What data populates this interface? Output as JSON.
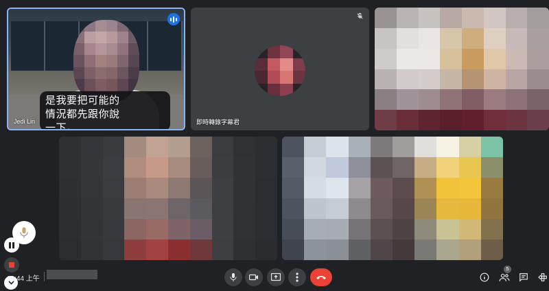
{
  "participants": [
    {
      "name": "Jedi Lin",
      "caption": "是我要把可能的情況都先跟你說一下。",
      "speaking": true
    },
    {
      "name": "即時轉錄字幕君",
      "muted": true
    },
    {
      "name": ""
    },
    {
      "name": ""
    },
    {
      "name": ""
    }
  ],
  "bottom_bar": {
    "time": "10:44 上午",
    "people_count": "5"
  },
  "colors": {
    "background": "#202124",
    "tile": "#3c4043",
    "leave": "#ea4335",
    "active_border": "#8ab4f8"
  },
  "icons": {
    "mic": "mic-icon",
    "camera": "camera-icon",
    "present": "present-screen-icon",
    "more": "more-vert-icon",
    "leave": "call-end-icon",
    "info": "info-icon",
    "people": "people-icon",
    "chat": "chat-icon",
    "activities": "activities-icon"
  },
  "mosaics": {
    "face": {
      "cols": 6,
      "rows": 7,
      "colors": [
        "#6f5a64",
        "#8b7783",
        "#a68c93",
        "#9c8590",
        "#7d6873",
        "#5b4b57",
        "#8a6f78",
        "#b99ea2",
        "#c3a7a6",
        "#b89a9d",
        "#9e828c",
        "#6e5a66",
        "#7a5f6a",
        "#a7858c",
        "#b6959a",
        "#a98b92",
        "#8f737e",
        "#5f4c58",
        "#6a525e",
        "#8e6f77",
        "#a1827f",
        "#9a7b7d",
        "#7e6570",
        "#574552",
        "#5c4652",
        "#7d5f67",
        "#8b6c6f",
        "#856669",
        "#6d5560",
        "#4d3c48",
        "#4e3b47",
        "#6c5058",
        "#7d5d61",
        "#74565b",
        "#5d4752",
        "#423440",
        "#433541",
        "#5a4550",
        "#6a5157",
        "#634b52",
        "#4f3e49",
        "#3a2f3a"
      ]
    },
    "avatar": {
      "cols": 4,
      "rows": 4,
      "colors": [
        "#2b2227",
        "#6d3440",
        "#934655",
        "#2b2227",
        "#5a2d3a",
        "#c45a61",
        "#e38b88",
        "#7f3c4a",
        "#4a2733",
        "#b14b55",
        "#d87672",
        "#6c3441",
        "#2b2227",
        "#6a2f3d",
        "#8c404f",
        "#2b2227"
      ]
    },
    "tile3": {
      "cols": 8,
      "rows": 6,
      "colors": [
        "#9a9393",
        "#b9b3b3",
        "#c9c3c0",
        "#b8aaa3",
        "#c9b9ae",
        "#d2c6c2",
        "#b9aeae",
        "#a49d9d",
        "#c9c4c4",
        "#e3dfdf",
        "#e9e6e4",
        "#d6c6a8",
        "#cfae7d",
        "#dfcfc1",
        "#c7b9b7",
        "#a99f9f",
        "#cfcbcb",
        "#ebe8e8",
        "#ebe8e6",
        "#d7c19b",
        "#c79c5e",
        "#e1c7a9",
        "#cbb9b3",
        "#ad9f9f",
        "#b8b2b3",
        "#d1cbcc",
        "#d4cdca",
        "#c6b6a5",
        "#b69372",
        "#ceb4a2",
        "#b8a6a4",
        "#9b8d8f",
        "#8c7f84",
        "#a1939a",
        "#9e8c8f",
        "#8f7377",
        "#815e63",
        "#9a7b7f",
        "#8d7378",
        "#7a6469",
        "#6e3d46",
        "#6a2e39",
        "#5e2430",
        "#5a1f2b",
        "#611f2d",
        "#702d3a",
        "#6c3441",
        "#6a3f4a"
      ]
    },
    "tile4": {
      "cols": 10,
      "rows": 6,
      "colors": [
        "#2e3033",
        "#33363a",
        "#393b3e",
        "#a38b80",
        "#c2a293",
        "#b39e90",
        "#6b615d",
        "#3a3c3f",
        "#2f3134",
        "#2c2e31",
        "#2e3033",
        "#34373a",
        "#3b3d40",
        "#b08d7e",
        "#c69a86",
        "#a78c7f",
        "#6a5e5c",
        "#3b3d40",
        "#303235",
        "#2c2e31",
        "#2d2f32",
        "#343639",
        "#3b3c3f",
        "#9b7d73",
        "#a88a7e",
        "#8e7a72",
        "#5b5558",
        "#3d3f42",
        "#303235",
        "#2b2d30",
        "#2c2e31",
        "#333538",
        "#393a3d",
        "#8a7670",
        "#8c7673",
        "#6e6568",
        "#5a5a5f",
        "#3e3f43",
        "#2f3134",
        "#2b2d30",
        "#2c2e31",
        "#323437",
        "#38393c",
        "#8b6662",
        "#9a6a66",
        "#7e6469",
        "#6a5d66",
        "#3f4044",
        "#2f3134",
        "#2b2d30",
        "#2b2d30",
        "#313336",
        "#37383b",
        "#8e3e3c",
        "#a24341",
        "#8c2f30",
        "#6f393b",
        "#3e3f42",
        "#2e3033",
        "#2a2c2f"
      ]
    },
    "tile5": {
      "cols": 10,
      "rows": 6,
      "colors": [
        "#4d5460",
        "#c6ccd3",
        "#dce3ea",
        "#a8b0b8",
        "#7d7a7c",
        "#a09e9d",
        "#e2dedb",
        "#f6f2e4",
        "#d6d0a2",
        "#7cc2a7",
        "#5a606b",
        "#d2d8df",
        "#c1cadd",
        "#8e8f98",
        "#5c5153",
        "#6f6565",
        "#c7ad86",
        "#f0d27a",
        "#e8c64f",
        "#8a8f6a",
        "#555b66",
        "#d6dce3",
        "#dfe5ec",
        "#a7a2a6",
        "#6d5b5d",
        "#5d4c4e",
        "#b09155",
        "#f0c33b",
        "#f2c53a",
        "#9a7b3f",
        "#4e545f",
        "#bec5cd",
        "#c5ccd4",
        "#8f8a8d",
        "#6b5a5c",
        "#574748",
        "#9b8556",
        "#e5b93d",
        "#e6b738",
        "#91743e",
        "#474d57",
        "#a6adb5",
        "#a6acb2",
        "#767476",
        "#5c5052",
        "#4e4244",
        "#8d8b79",
        "#c8c294",
        "#d1b877",
        "#83704d",
        "#3f444d",
        "#8d939a",
        "#8b9096",
        "#606165",
        "#4e4649",
        "#44393b",
        "#797a76",
        "#a9a88e",
        "#b2a07a",
        "#6d5e49"
      ]
    }
  }
}
